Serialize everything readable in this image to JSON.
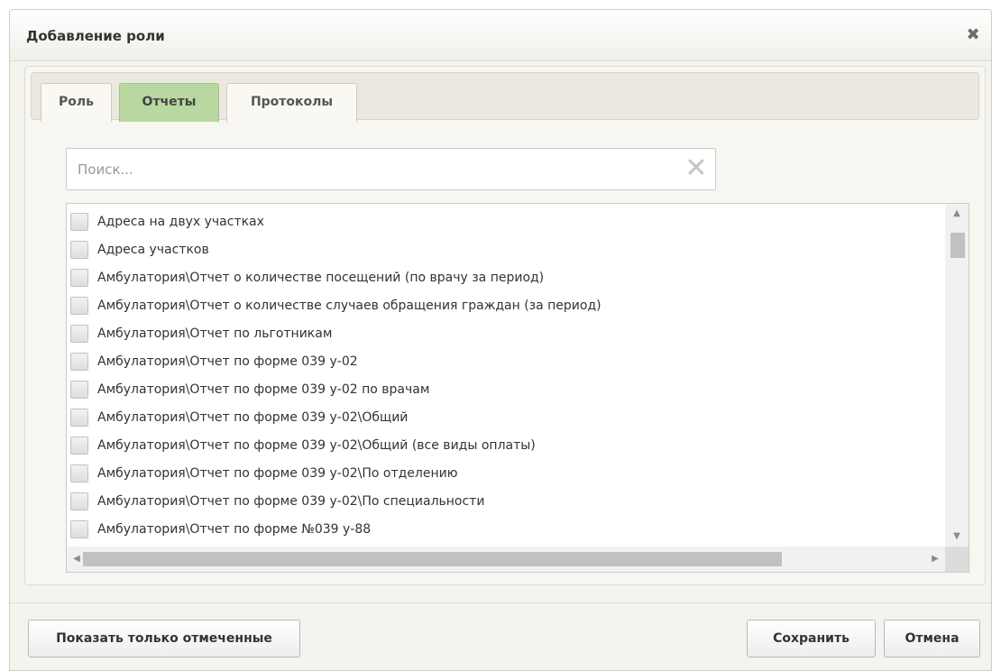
{
  "dialog": {
    "title": "Добавление роли",
    "close_glyph": "✖"
  },
  "tabs": [
    {
      "label": "Роль",
      "active": false
    },
    {
      "label": "Отчеты",
      "active": true
    },
    {
      "label": "Протоколы",
      "active": false
    }
  ],
  "search": {
    "placeholder": "Поиск...",
    "value": "",
    "clear_glyph": "✕"
  },
  "reports": [
    {
      "label": "Адреса на двух участках",
      "checked": false
    },
    {
      "label": "Адреса участков",
      "checked": false
    },
    {
      "label": "Амбулатория\\Отчет о количестве посещений (по врачу за период)",
      "checked": false
    },
    {
      "label": "Амбулатория\\Отчет о количестве случаев обращения граждан (за период)",
      "checked": false
    },
    {
      "label": "Амбулатория\\Отчет по льготникам",
      "checked": false
    },
    {
      "label": "Амбулатория\\Отчет по форме 039 у-02",
      "checked": false
    },
    {
      "label": "Амбулатория\\Отчет по форме 039 у-02 по врачам",
      "checked": false
    },
    {
      "label": "Амбулатория\\Отчет по форме 039 у-02\\Общий",
      "checked": false
    },
    {
      "label": "Амбулатория\\Отчет по форме 039 у-02\\Общий (все виды оплаты)",
      "checked": false
    },
    {
      "label": "Амбулатория\\Отчет по форме 039 у-02\\По отделению",
      "checked": false
    },
    {
      "label": "Амбулатория\\Отчет по форме 039 у-02\\По специальности",
      "checked": false
    },
    {
      "label": "Амбулатория\\Отчет по форме №039 у-88",
      "checked": false
    }
  ],
  "footer": {
    "show_checked_label": "Показать только отмеченные",
    "save_label": "Сохранить",
    "cancel_label": "Отмена"
  }
}
